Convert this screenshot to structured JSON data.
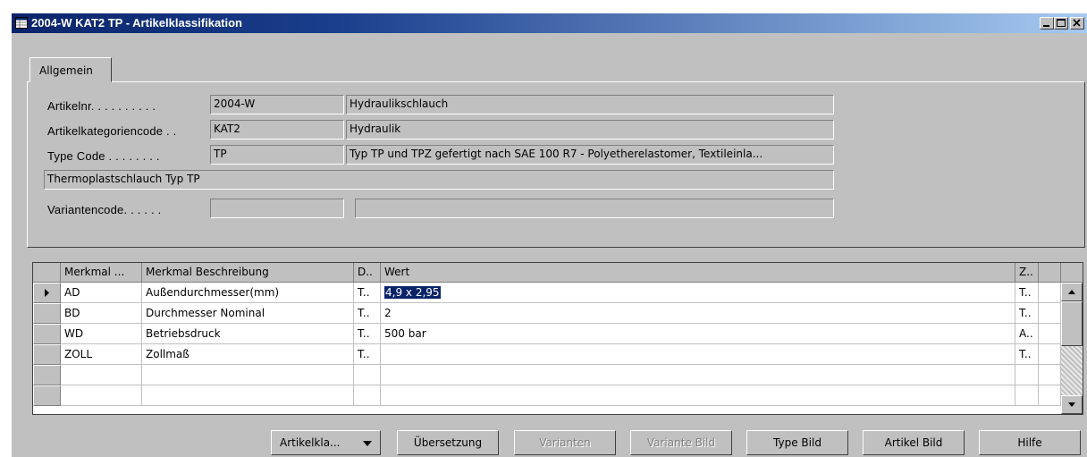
{
  "window": {
    "title": "2004-W KAT2 TP - Artikelklassifikation"
  },
  "tabs": [
    {
      "label": "Allgemein"
    }
  ],
  "form": {
    "artikelnr": {
      "label": "Artikelnr. . . . . . . . . .",
      "code": "2004-W",
      "desc": "Hydraulikschlauch"
    },
    "kategorie": {
      "label": "Artikelkategoriencode . .",
      "code": "KAT2",
      "desc": "Hydraulik"
    },
    "typecode": {
      "label": "Type Code . . . . . . . .",
      "code": "TP",
      "desc": "Typ TP und TPZ gefertigt nach SAE 100 R7 - Polyetherelastomer, Textileinla..."
    },
    "description": "Thermoplastschlauch Typ TP",
    "variante": {
      "label": "Variantencode. . . . . .",
      "code": "",
      "desc": ""
    }
  },
  "grid": {
    "headers": [
      "Merkmal ...",
      "Merkmal Beschreibung",
      "D..",
      "Wert",
      "Z.."
    ],
    "rows": [
      {
        "code": "AD",
        "beschreibung": "Außendurchmesser(mm)",
        "d": "T..",
        "wert": "4,9 x 2,95",
        "z": "T.."
      },
      {
        "code": "BD",
        "beschreibung": "Durchmesser Nominal",
        "d": "T..",
        "wert": "2",
        "z": "T.."
      },
      {
        "code": "WD",
        "beschreibung": "Betriebsdruck",
        "d": "T..",
        "wert": "500 bar",
        "z": "A.."
      },
      {
        "code": "ZOLL",
        "beschreibung": "Zollmaß",
        "d": "T..",
        "wert": "",
        "z": "T.."
      }
    ]
  },
  "buttons": {
    "artikelklassifikation": "Artikelkla...",
    "uebersetzung": "Übersetzung",
    "varianten": "Varianten",
    "variante_bild": "Variante Bild",
    "type_bild": "Type Bild",
    "artikel_bild": "Artikel Bild",
    "hilfe": "Hilfe"
  },
  "colors": {
    "titlebar": "#0a246a",
    "selection": "#0a246a",
    "face": "#c0c0c0"
  }
}
